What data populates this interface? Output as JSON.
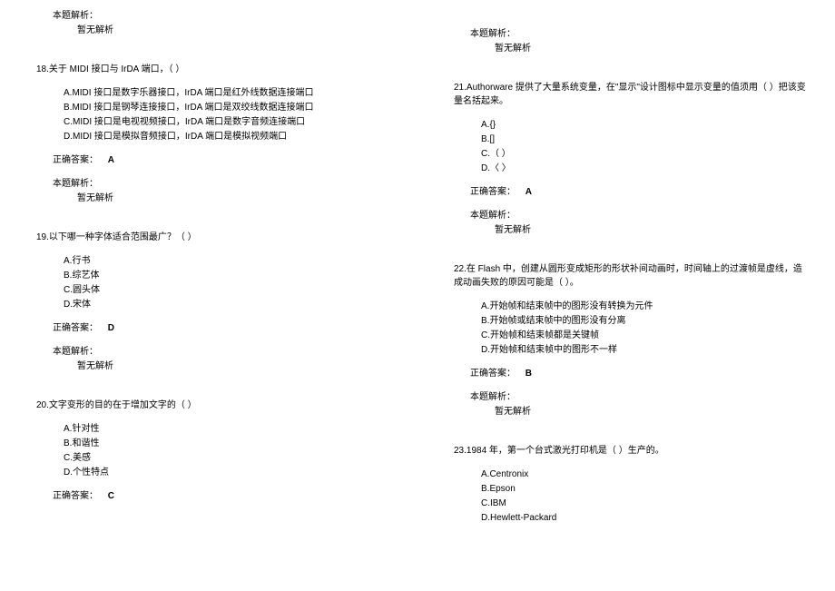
{
  "left": {
    "pre_analysis_title": "本题解析：",
    "pre_analysis_content": "暂无解析",
    "q18": {
      "title": "18.关于 MIDI 接口与 IrDA 端口，（ ）",
      "options": {
        "a": "A.MIDI 接口是数字乐器接口，IrDA 端口是红外线数据连接端口",
        "b": "B.MIDI 接口是钢琴连接接口，IrDA 端口是双绞线数据连接端口",
        "c": "C.MIDI 接口是电视视频接口，IrDA 端口是数字音频连接端口",
        "d": "D.MIDI 接口是模拟音频接口，IrDA 端口是模拟视频端口"
      },
      "answer_label": "正确答案：",
      "answer": "A",
      "analysis_title": "本题解析：",
      "analysis_content": "暂无解析"
    },
    "q19": {
      "title": "19.以下哪一种字体适合范围最广？（ ）",
      "options": {
        "a": "A.行书",
        "b": "B.综艺体",
        "c": "C.圆头体",
        "d": "D.宋体"
      },
      "answer_label": "正确答案：",
      "answer": "D",
      "analysis_title": "本题解析：",
      "analysis_content": "暂无解析"
    },
    "q20": {
      "title": "20.文字变形的目的在于增加文字的（ ）",
      "options": {
        "a": "A.针对性",
        "b": "B.和谐性",
        "c": "C.美感",
        "d": "D.个性特点"
      },
      "answer_label": "正确答案：",
      "answer": "C"
    }
  },
  "right": {
    "pre_analysis_title": "本题解析：",
    "pre_analysis_content": "暂无解析",
    "q21": {
      "title": "21.Authorware 提供了大量系统变量，在\"显示\"设计图标中显示变量的值须用（ ）把该变量名括起来。",
      "options": {
        "a": "A.{}",
        "b": "B.[]",
        "c": "C.（ ）",
        "d": "D.〈 〉"
      },
      "answer_label": "正确答案：",
      "answer": "A",
      "analysis_title": "本题解析：",
      "analysis_content": "暂无解析"
    },
    "q22": {
      "title": "22.在 Flash 中，创建从圆形变成矩形的形状补间动画时，时间轴上的过渡帧是虚线，造成动画失败的原因可能是（ ）。",
      "options": {
        "a": "A.开始帧和结束帧中的图形没有转换为元件",
        "b": "B.开始帧或结束帧中的图形没有分离",
        "c": "C.开始帧和结束帧都是关键帧",
        "d": "D.开始帧和结束帧中的图形不一样"
      },
      "answer_label": "正确答案：",
      "answer": "B",
      "analysis_title": "本题解析：",
      "analysis_content": "暂无解析"
    },
    "q23": {
      "title": "23.1984 年，第一个台式激光打印机是（ ）生产的。",
      "options": {
        "a": "A.Centronix",
        "b": "B.Epson",
        "c": "C.IBM",
        "d": "D.Hewlett-Packard"
      }
    }
  }
}
